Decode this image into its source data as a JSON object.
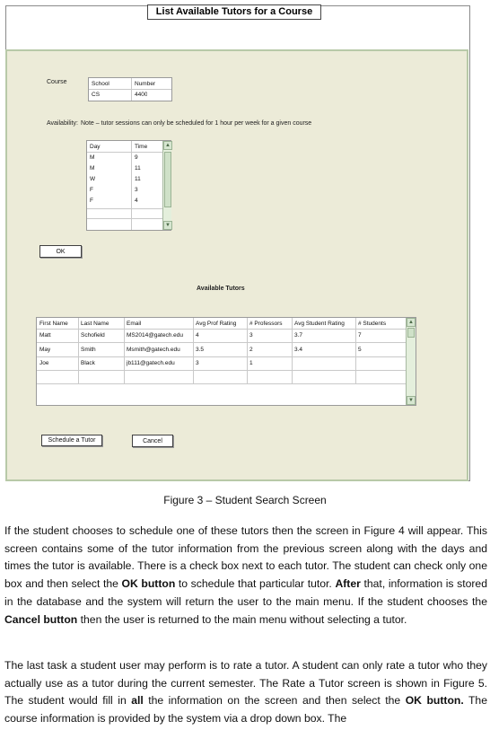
{
  "figure": {
    "title": "List Available Tutors for a Course",
    "course_label": "Course",
    "course_table": {
      "headers": [
        "School",
        "Number"
      ],
      "row": [
        "CS",
        "4400"
      ]
    },
    "availability_label": "Availability:",
    "availability_note": "Note – tutor sessions can only be scheduled for 1 hour per week for a given course",
    "availability_table": {
      "headers": [
        "Day",
        "Time"
      ],
      "rows": [
        [
          "M",
          "9"
        ],
        [
          "M",
          "11"
        ],
        [
          "W",
          "11"
        ],
        [
          "F",
          "3"
        ],
        [
          "F",
          "4"
        ]
      ]
    },
    "ok_label": "OK",
    "tutors_heading": "Available Tutors",
    "tutors_table": {
      "headers": [
        "First Name",
        "Last Name",
        "Email",
        "Avg Prof Rating",
        "# Professors",
        "Avg Student Rating",
        "# Students"
      ],
      "rows": [
        [
          "Matt",
          "Schofield",
          "MS2014@gatech.edu",
          "4",
          "3",
          "3.7",
          "7"
        ],
        [
          "May",
          "Smith",
          "Msmith@gatech.edu",
          "3.5",
          "2",
          "3.4",
          "5"
        ],
        [
          "Joe",
          "Black",
          "jb111@gatech.edu",
          "3",
          "1",
          "",
          ""
        ]
      ]
    },
    "schedule_label": "Schedule a Tutor",
    "cancel_label": "Cancel"
  },
  "caption": "Figure 3 – Student Search Screen",
  "paragraphs": [
    {
      "parts": [
        "If the student chooses to schedule one of these tutors then the screen in Figure 4 will appear. This screen contains some of the tutor information from the previous screen along with the days and times the tutor is available. There is a check  box next  to each tutor.  The student can check only one box and then select the ",
        "OK button",
        " to schedule that particular tutor. ",
        "After",
        " that, information is stored in the database and the system will return the user to the main menu. If the student chooses the ",
        "Cancel button",
        " then the user is returned to the main menu without selecting a tutor."
      ]
    },
    {
      "parts": [
        "The last task a student user may perform is to rate a tutor. A student can only rate a tutor who they actually use as a tutor during the current semester. The Rate a Tutor screen is shown in Figure 5. The student would fill in ",
        "all",
        " the information on the screen and then select the ",
        "OK button.",
        " The course information is provided by the system via a drop down box. The"
      ]
    }
  ]
}
